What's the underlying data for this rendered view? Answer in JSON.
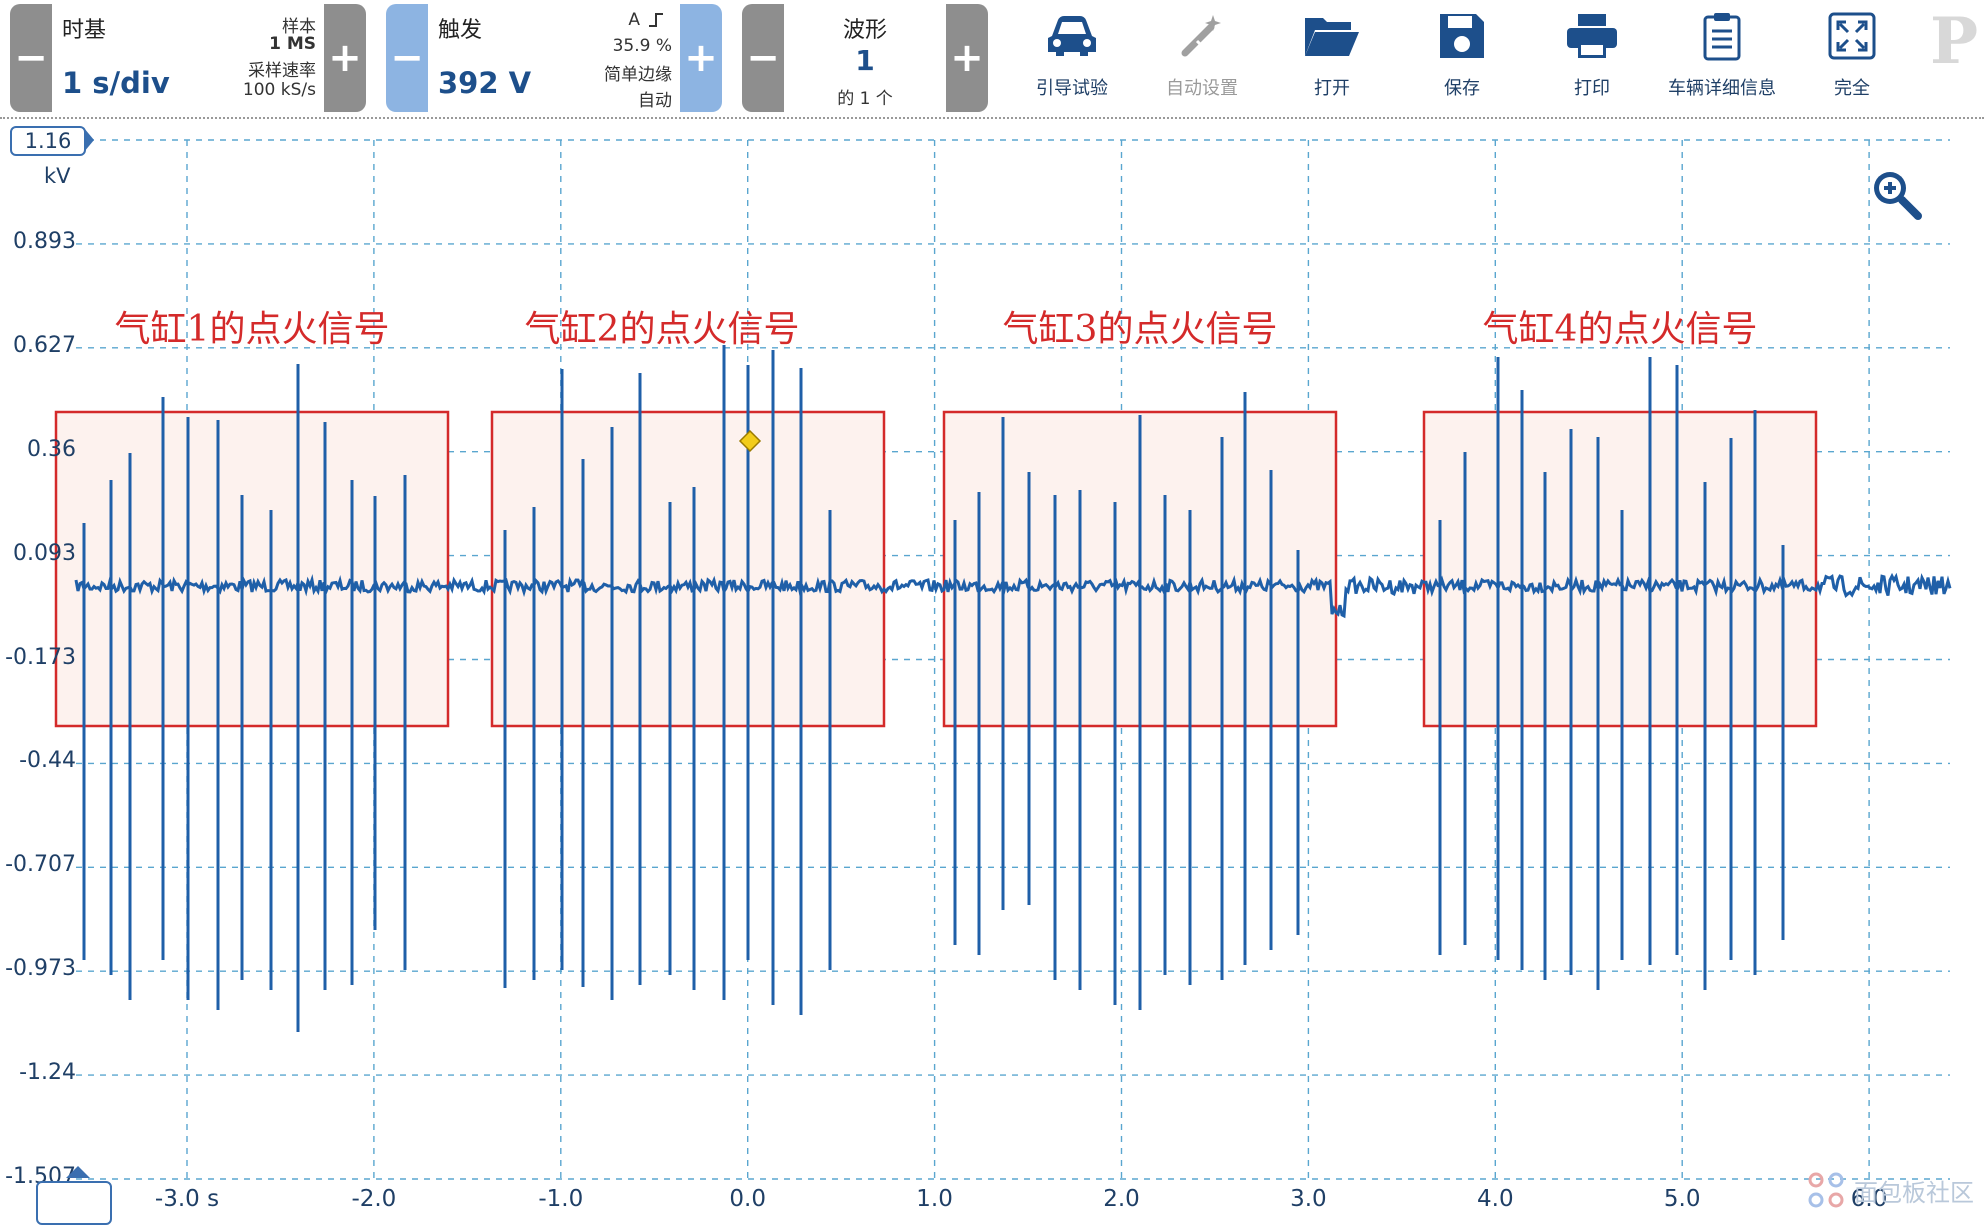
{
  "toolbar": {
    "timebase": {
      "label": "时基",
      "value": "1 s/div",
      "samples_label": "样本",
      "samples_value": "1 MS",
      "rate_label": "采样速率",
      "rate_value": "100 kS/s",
      "minus": "−",
      "plus": "+"
    },
    "trigger": {
      "label": "触发",
      "value": "392 V",
      "channel": "A",
      "percent": "35.9 %",
      "type": "简单边缘",
      "mode": "自动",
      "minus": "−",
      "plus": "+"
    },
    "waveform": {
      "label": "波形",
      "value": "1",
      "of": "的 1 个",
      "minus": "−",
      "plus": "+"
    },
    "tools": [
      {
        "label": "引导试验",
        "icon": "car-icon",
        "enabled": true
      },
      {
        "label": "自动设置",
        "icon": "wand-icon",
        "enabled": false
      },
      {
        "label": "打开",
        "icon": "folder-open-icon",
        "enabled": true
      },
      {
        "label": "保存",
        "icon": "floppy-disk-icon",
        "enabled": true
      },
      {
        "label": "打印",
        "icon": "printer-icon",
        "enabled": true
      },
      {
        "label": "车辆详细信息",
        "icon": "clipboard-icon",
        "enabled": true
      },
      {
        "label": "完全",
        "icon": "fullscreen-icon",
        "enabled": true
      }
    ],
    "logo": "P"
  },
  "plot": {
    "y_max_label": "1.16",
    "y_unit": "kV",
    "y_ticks": [
      "0.893",
      "0.627",
      "0.36",
      "0.093",
      "-0.173",
      "-0.44",
      "-0.707",
      "-0.973",
      "-1.24",
      "-1.507"
    ],
    "x_ticks": [
      "-3.0 s",
      "-2.0",
      "-1.0",
      "0.0",
      "1.0",
      "2.0",
      "3.0",
      "4.0",
      "5.0",
      "6.0"
    ],
    "trace_color": "#1f5fa8",
    "grid_color": "#5aa6cf",
    "trigger_marker_color": "#f2cc1a"
  },
  "annotations": [
    {
      "label": "气缸1的点火信号"
    },
    {
      "label": "气缸2的点火信号"
    },
    {
      "label": "气缸3的点火信号"
    },
    {
      "label": "气缸4的点火信号"
    }
  ],
  "annotation_color": "#d42a2a",
  "watermark": {
    "text": "面包板社区"
  }
}
